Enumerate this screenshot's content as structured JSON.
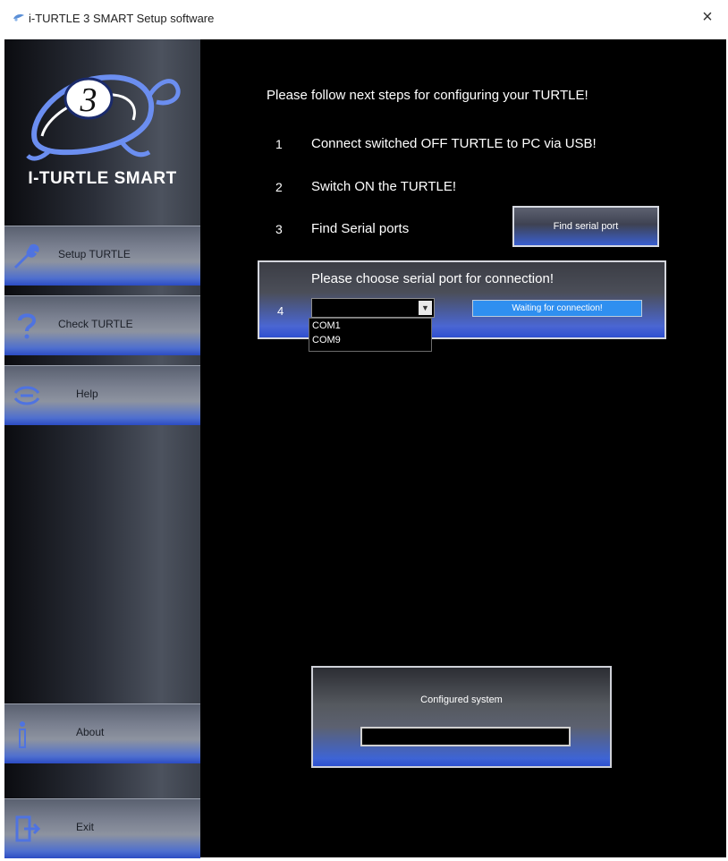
{
  "window": {
    "title": "i-TURTLE 3 SMART Setup software",
    "close_glyph": "×"
  },
  "sidebar": {
    "logo_number": "3",
    "brand": "I-TURTLE SMART",
    "items": [
      {
        "label": "Setup TURTLE",
        "icon": "wrench-icon"
      },
      {
        "label": "Check TURTLE",
        "icon": "question-icon"
      },
      {
        "label": "Help",
        "icon": "help-icon"
      },
      {
        "label": "About",
        "icon": "info-icon"
      },
      {
        "label": "Exit",
        "icon": "exit-door-icon"
      }
    ]
  },
  "main": {
    "intro": "Please follow next steps for configuring your TURTLE!",
    "steps": [
      {
        "num": "1",
        "text": "Connect switched OFF TURTLE to PC via USB!"
      },
      {
        "num": "2",
        "text": "Switch ON the TURTLE!"
      },
      {
        "num": "3",
        "text": "Find Serial ports"
      }
    ],
    "find_button": "Find serial port",
    "choose": {
      "num": "4",
      "title": "Please choose serial port for connection!",
      "selected": "",
      "options": [
        "COM1",
        "COM9"
      ],
      "status": "Waiting for connection!"
    },
    "configured": {
      "label": "Configured system",
      "value": ""
    }
  },
  "colors": {
    "accent_blue": "#2f4fd0",
    "status_blue": "#2f8ff0",
    "background": "#000000"
  }
}
